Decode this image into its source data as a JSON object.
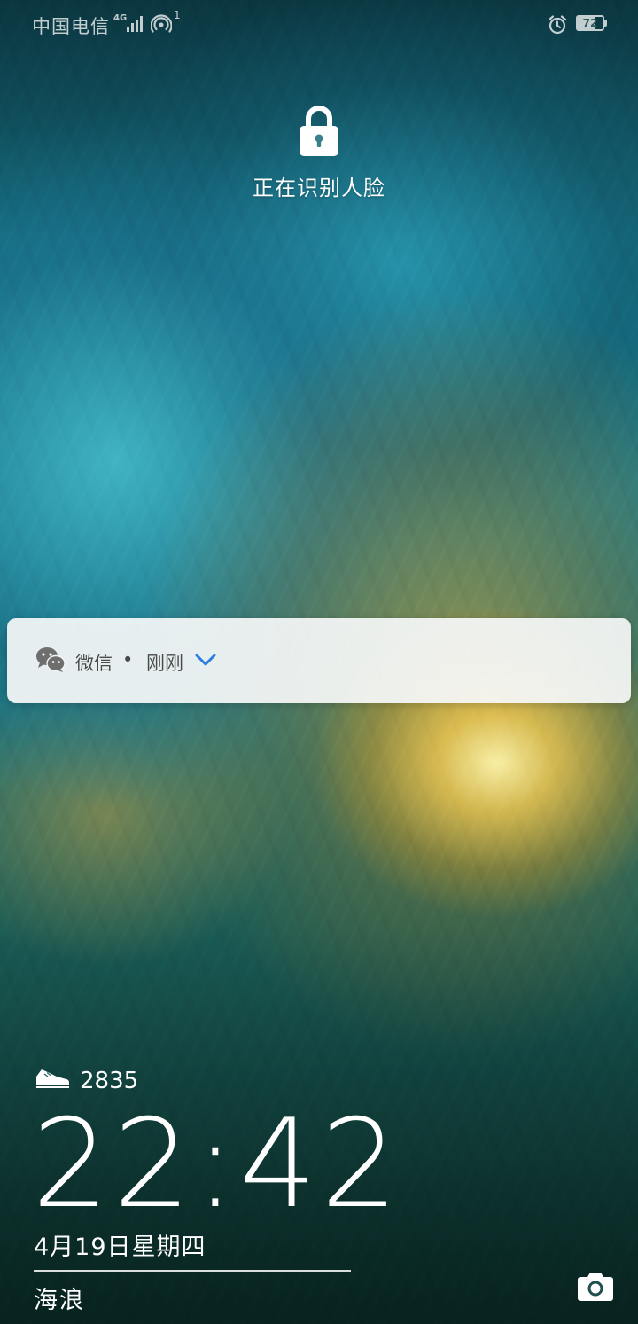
{
  "status_bar": {
    "carrier": "中国电信",
    "network_type": "4G",
    "hotspot_count": "1",
    "battery_level": "72",
    "battery_fraction": 0.72,
    "icons": [
      "signal-icon",
      "hotspot-icon",
      "alarm-icon",
      "battery-icon"
    ]
  },
  "lock": {
    "icon": "lock-icon",
    "status_text": "正在识别人脸"
  },
  "notification": {
    "icon": "wechat-icon",
    "app_name": "微信",
    "separator": "•",
    "time": "刚刚",
    "expand_icon": "chevron-down-icon",
    "accent_color": "#2f7de1"
  },
  "steps": {
    "icon": "sneaker-icon",
    "count": "2835"
  },
  "clock": {
    "time": "22:42",
    "date": "4月19日星期四"
  },
  "magazine": {
    "title": "海浪"
  },
  "camera": {
    "icon": "camera-icon"
  }
}
